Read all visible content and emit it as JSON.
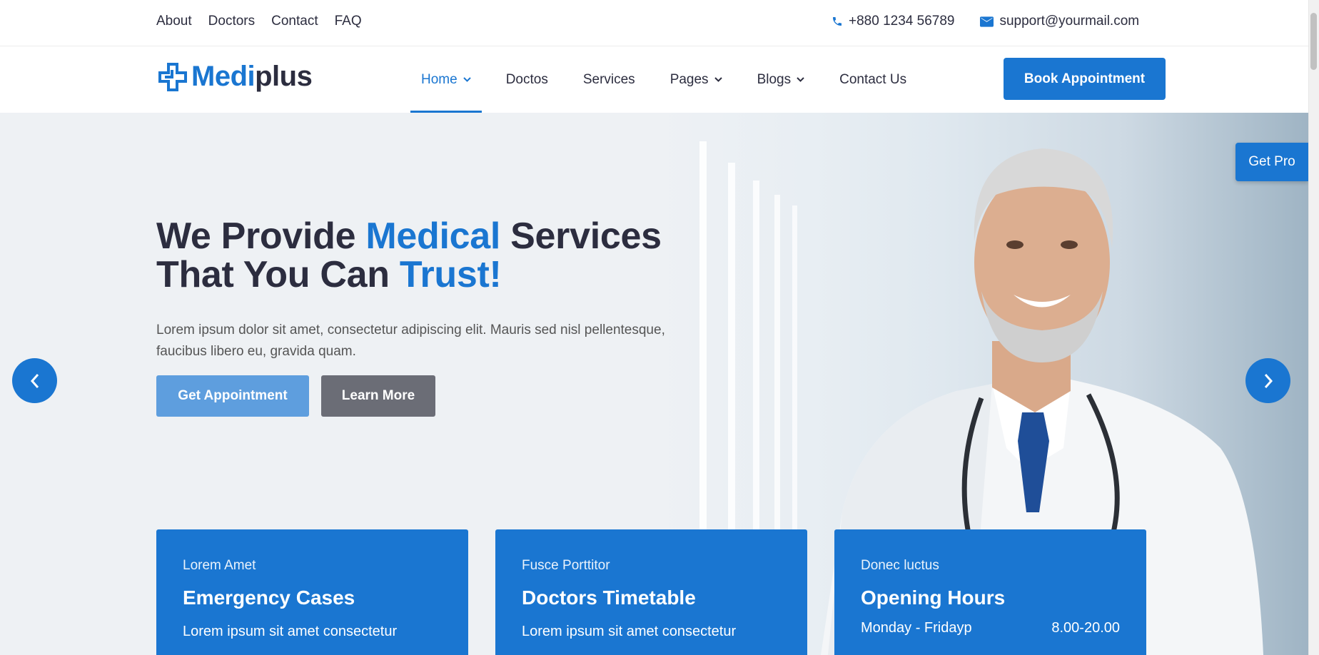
{
  "topbar": {
    "links": [
      "About",
      "Doctors",
      "Contact",
      "FAQ"
    ],
    "phone": "+880 1234 56789",
    "email": "support@yourmail.com"
  },
  "header": {
    "logo_part1": "Medi",
    "logo_part2": "plus",
    "nav": [
      "Home",
      "Doctos",
      "Services",
      "Pages",
      "Blogs",
      "Contact Us"
    ],
    "book_button": "Book Appointment"
  },
  "hero": {
    "title_line1_a": "We Provide ",
    "title_line1_b": "Medical",
    "title_line1_c": " Services",
    "title_line2_a": "That You Can ",
    "title_line2_b": "Trust!",
    "text": "Lorem ipsum dolor sit amet, consectetur adipiscing elit. Mauris sed nisl pellentesque, faucibus libero eu, gravida quam.",
    "primary_button": "Get Appointment",
    "secondary_button": "Learn More",
    "get_pro": "Get Pro"
  },
  "cards": [
    {
      "kicker": "Lorem Amet",
      "title": "Emergency Cases",
      "desc": "Lorem ipsum sit amet consectetur"
    },
    {
      "kicker": "Fusce Porttitor",
      "title": "Doctors Timetable",
      "desc": "Lorem ipsum sit amet consectetur"
    },
    {
      "kicker": "Donec luctus",
      "title": "Opening Hours",
      "day": "Monday - Fridayp",
      "time": "8.00-20.00"
    }
  ],
  "colors": {
    "accent": "#1A76D1",
    "dark": "#2C2D3F",
    "muted_button": "#6B6D76"
  },
  "icons": [
    "phone-icon",
    "mail-icon",
    "logo-cross-icon",
    "chevron-down-icon",
    "arrow-left-icon",
    "arrow-right-icon"
  ]
}
